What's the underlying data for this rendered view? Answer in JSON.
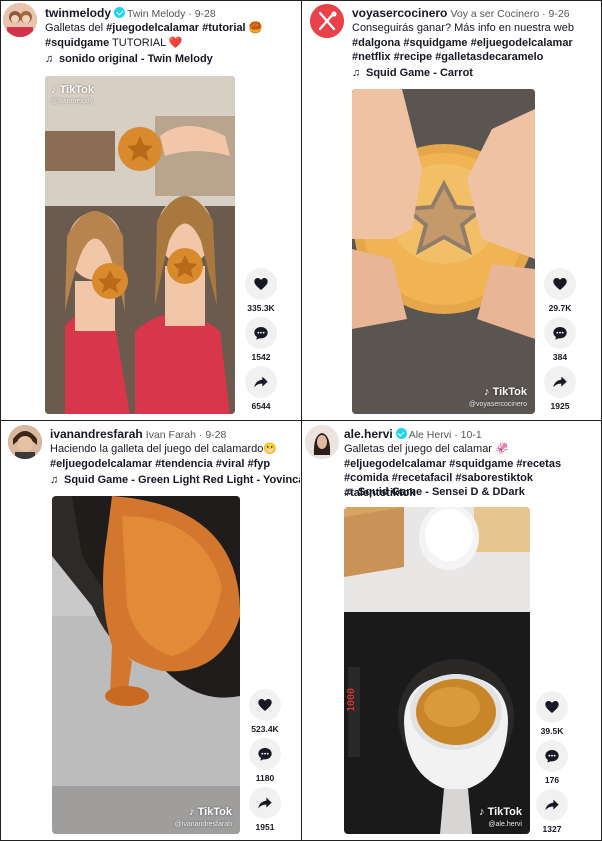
{
  "colors": {
    "accent": "#fe2c55",
    "verified": "#20d5ec",
    "text": "#161823",
    "muted": "#555555",
    "button_bg": "#f1f1f2"
  },
  "posts": [
    {
      "username": "twinmelody",
      "display_name": "Twin Melody",
      "verified": true,
      "date": "9-28",
      "caption_parts": [
        "Galletas del ",
        "#juegodelcalamar",
        " ",
        "#tutorial",
        " ",
        "🥮",
        " ",
        "#squidgame",
        " TUTORIAL ",
        "❤️"
      ],
      "sound": "sonido original - Twin Melody",
      "watermark": "TikTok",
      "watermark_handle": "@twinmelody",
      "likes": "335.3K",
      "comments": "1542",
      "shares": "6544"
    },
    {
      "username": "voyasercocinero",
      "display_name": "Voy a ser Cocinero",
      "verified": false,
      "date": "9-26",
      "caption_parts": [
        "Conseguirás ganar? Más info en nuestra web ",
        "#dalgona",
        " ",
        "#squidgame",
        " ",
        "#eljuegodelcalamar",
        " ",
        "#netflix",
        " ",
        "#recipe",
        " ",
        "#galletasdecaramelo"
      ],
      "sound": "Squid Game - Carrot",
      "watermark": "TikTok",
      "watermark_handle": "@voyasercocinero",
      "likes": "29.7K",
      "comments": "384",
      "shares": "1925"
    },
    {
      "username": "ivanandresfarah",
      "display_name": "Ivan Farah",
      "verified": false,
      "date": "9-28",
      "caption_parts": [
        "Haciendo la galleta del juego del calamardo",
        "😬",
        " ",
        "#eljuegodelcalamar",
        " ",
        "#tendencia",
        " ",
        "#viral",
        " ",
        "#fyp"
      ],
      "sound": "Squid Game - Green Light Red Light - Yovinca Prafika",
      "watermark": "TikTok",
      "watermark_handle": "@ivanandresfarah",
      "likes": "523.4K",
      "comments": "1180",
      "shares": "1951"
    },
    {
      "username": "ale.hervi",
      "display_name": "Ale Hervi",
      "verified": true,
      "date": "10-1",
      "caption_parts": [
        "Galletas del juego del calamar ",
        "🦑",
        " ",
        "#eljuegodelcalamar",
        " ",
        "#squidgame",
        " ",
        "#recetas",
        " ",
        "#comida",
        " ",
        "#recetafacil",
        " ",
        "#saborestiktok",
        " ",
        "#talentotiktok"
      ],
      "sound": "Squid Game - Sensei D & DDark",
      "watermark": "TikTok",
      "watermark_handle": "@ale.hervi",
      "likes": "39.5K",
      "comments": "176",
      "shares": "1327",
      "stove_display": "1000"
    }
  ]
}
